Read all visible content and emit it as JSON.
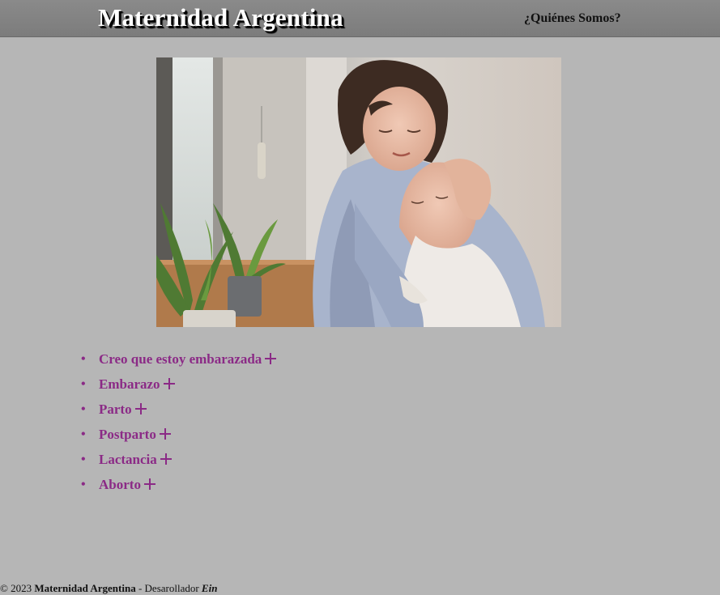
{
  "header": {
    "site_title": "Maternidad Argentina",
    "nav_link": "¿Quiénes Somos?"
  },
  "hero": {
    "alt": "Madre abrazando a su bebé junto a la ventana"
  },
  "topics": [
    {
      "label": "Creo que estoy embarazada",
      "icon": "plus-icon"
    },
    {
      "label": "Embarazo",
      "icon": "plus-icon"
    },
    {
      "label": "Parto",
      "icon": "plus-icon"
    },
    {
      "label": "Postparto",
      "icon": "plus-icon"
    },
    {
      "label": "Lactancia",
      "icon": "plus-icon"
    },
    {
      "label": "Aborto",
      "icon": "plus-icon"
    }
  ],
  "footer": {
    "copyright": "© 2023",
    "site_name": "Maternidad Argentina",
    "separator": "- Desarollador",
    "developer": "Ein"
  },
  "colors": {
    "background": "#b6b6b6",
    "header": "#808080",
    "accent": "#8b2a86"
  }
}
